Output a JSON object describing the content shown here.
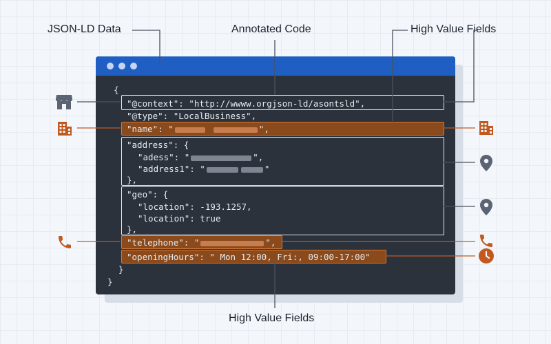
{
  "callouts": {
    "jsonld": "JSON-LD Data",
    "annotated": "Annotated Code",
    "high_value_top": "High Value Fields",
    "high_value_bottom": "High Value Fields"
  },
  "code": {
    "open_brace": "{",
    "context_line": "\"@context\": \"http://wwww.orgjson-ld/asontsld\",",
    "type_line": "\"@type\": \"LocalBusiness\",",
    "name_key": "\"name\": \"",
    "name_end": "\",",
    "address_open": "\"address\": {",
    "adess_key": "\"adess\": \"",
    "adess_end": "\",",
    "address1_key": "\"address1\": \"",
    "address1_end": "\"",
    "address_close": "},",
    "geo_open": "\"geo\": {",
    "location1": "\"location\": -193.1257,",
    "location2": "\"location\": true",
    "geo_close": "},",
    "telephone_key": "\"telephone\": \"",
    "telephone_end": "\",",
    "opening_hours": "\"openingHours\": \" Mon 12:00, Fri:, 09:00-17:00\"",
    "inner_close": "}",
    "outer_close": "}"
  },
  "icons": {
    "left": [
      "store-icon",
      "building-icon",
      "phone-icon"
    ],
    "right": [
      "building-icon",
      "location-pin-icon",
      "location-pin-icon",
      "phone-icon",
      "clock-icon"
    ]
  },
  "colors": {
    "titlebar": "#1f5fc4",
    "code_bg": "#2b323c",
    "highlight": "#8a4a1c",
    "accent_orange": "#c2591f",
    "icon_gray": "#5b6472"
  }
}
